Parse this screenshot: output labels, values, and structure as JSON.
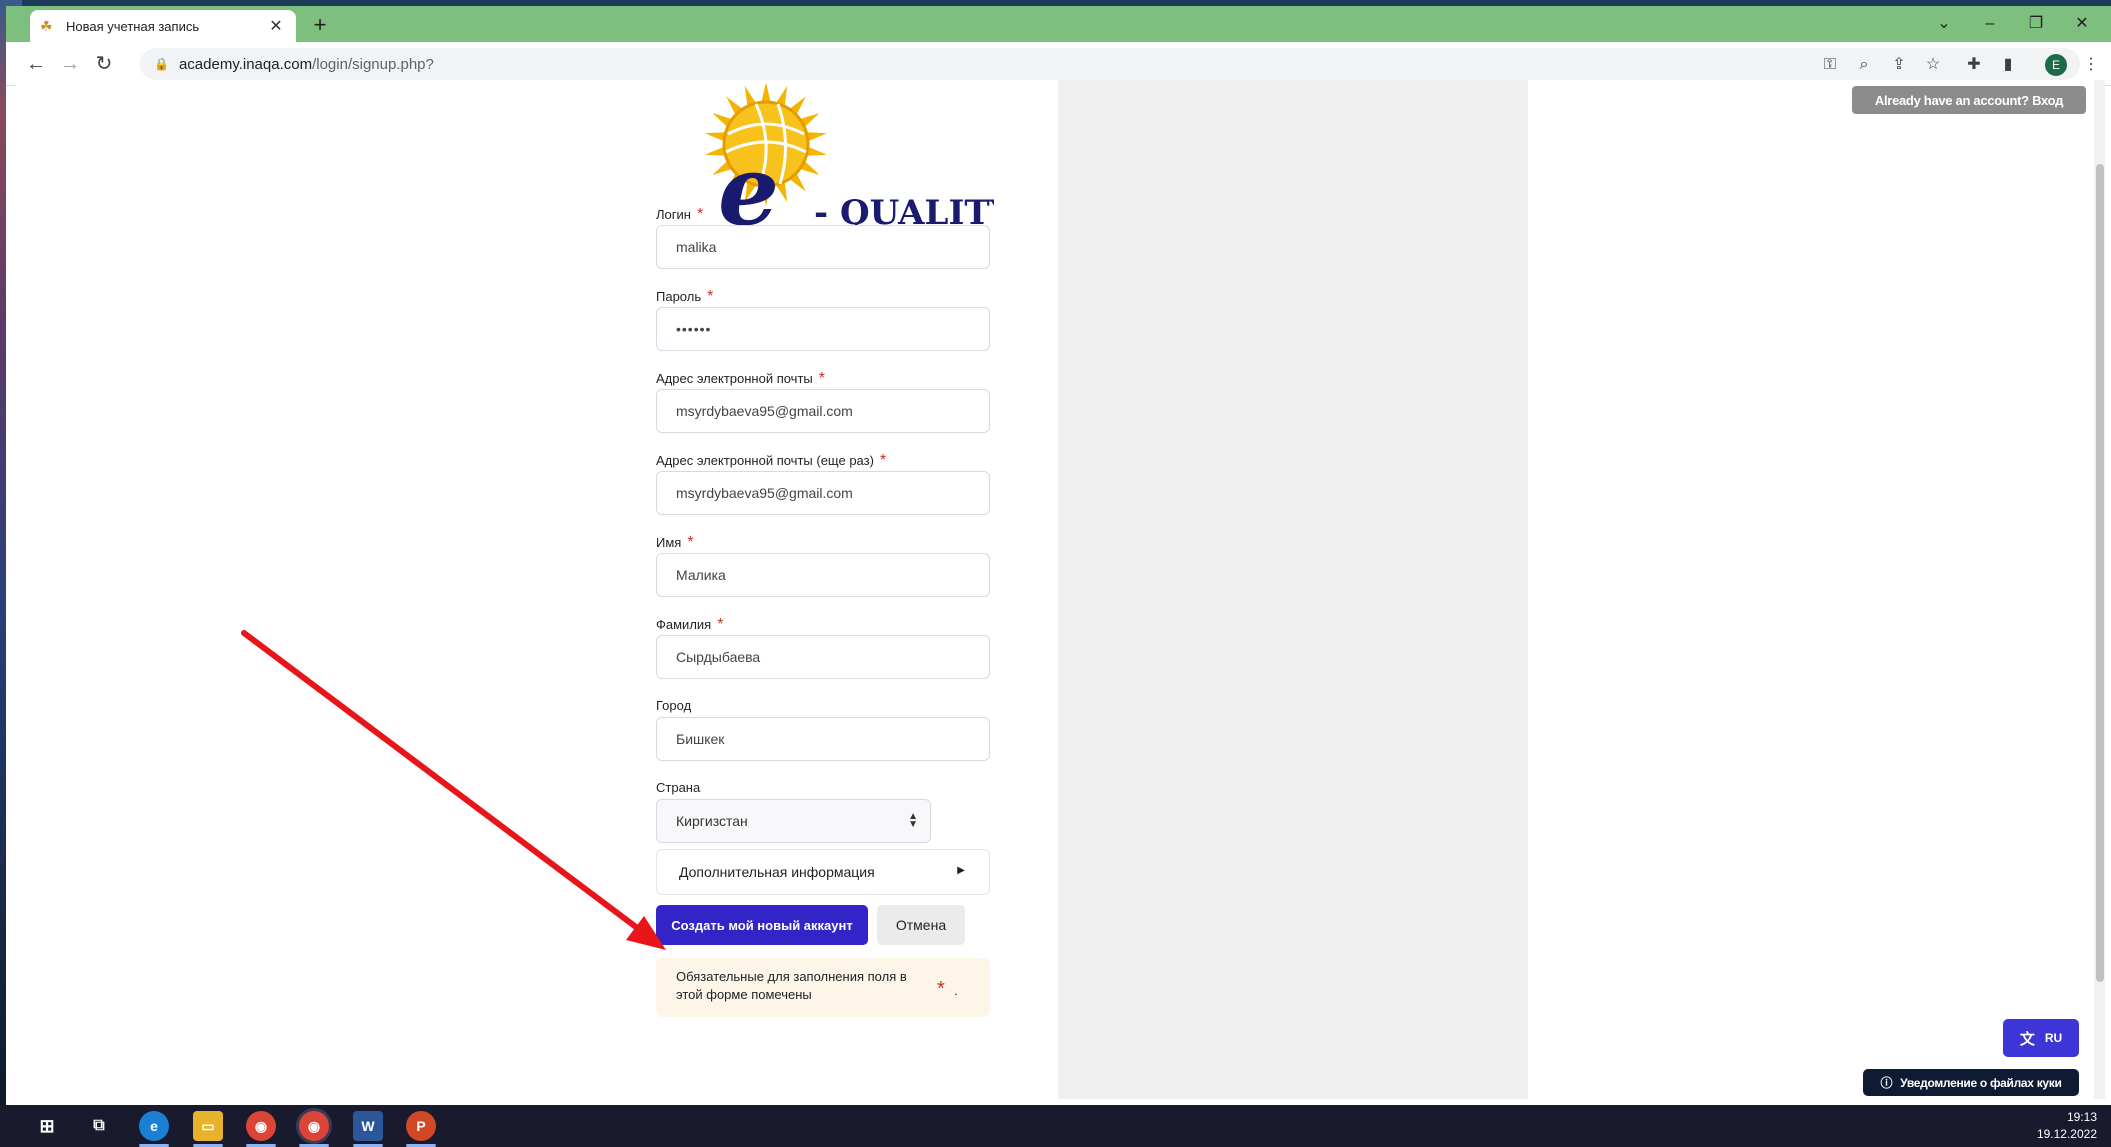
{
  "browser": {
    "tab_title": "Новая учетная запись",
    "url_domain": "academy.inaqa.com",
    "url_path": "/login/signup.php?",
    "avatar_letter": "E"
  },
  "header": {
    "login_link": "Already have an account? Вход"
  },
  "form": {
    "fields": [
      {
        "label": "Логин",
        "required": "*",
        "value": "malika"
      },
      {
        "label": "Пароль",
        "required": "*",
        "value": "••••••"
      },
      {
        "label": "Адрес электронной почты",
        "required": "*",
        "value": "msyrdybaeva95@gmail.com"
      },
      {
        "label": "Адрес электронной почты (еще раз)",
        "required": "*",
        "value": "msyrdybaeva95@gmail.com"
      },
      {
        "label": "Имя",
        "required": "*",
        "value": "Малика"
      },
      {
        "label": "Фамилия",
        "required": "*",
        "value": "Сырдыбаева"
      },
      {
        "label": "Город",
        "value": "Бишкек"
      }
    ],
    "country": {
      "label": "Страна",
      "value": "Киргизстан"
    },
    "more_info": "Дополнительная информация",
    "submit": "Создать мой новый аккаунт",
    "cancel": "Отмена",
    "required_notice": "Обязательные для заполнения поля в этой форме помечены",
    "required_symbol": "*",
    "required_period": "."
  },
  "widgets": {
    "lang": "RU",
    "cookie": "Уведомление о файлах куки"
  },
  "taskbar": {
    "time": "19:13",
    "date": "19.12.2022"
  },
  "colors": {
    "tabstrip": "#7dbf7e",
    "primary": "#3324c8",
    "required": "#ca3120",
    "annotation_arrow": "#e8161b"
  }
}
